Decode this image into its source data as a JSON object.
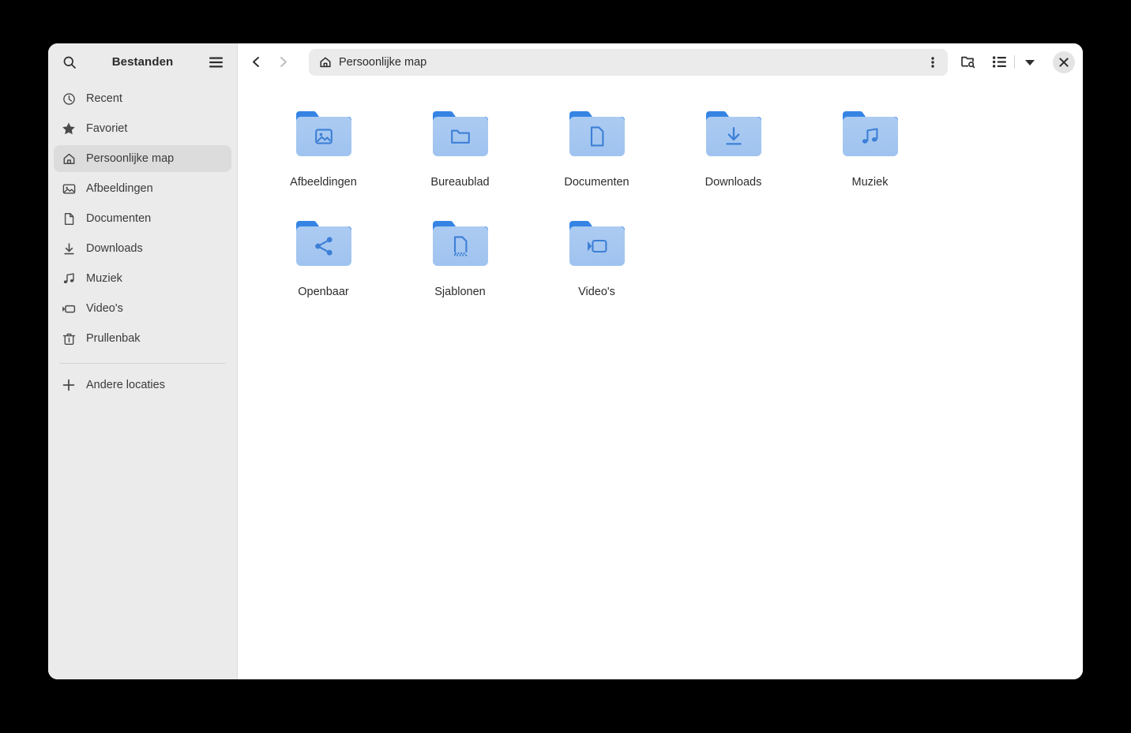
{
  "window": {
    "app_title": "Bestanden",
    "background_color": "#000000",
    "surface_color": "#ffffff",
    "sidebar_color": "#ebebeb",
    "accent_color": "#3584e4"
  },
  "sidebar": {
    "title": "Bestanden",
    "search_icon": "search-icon",
    "menu_icon": "hamburger-menu-icon",
    "items": [
      {
        "label": "Recent",
        "icon": "clock-icon",
        "selected": false
      },
      {
        "label": "Favoriet",
        "icon": "star-icon",
        "selected": false
      },
      {
        "label": "Persoonlijke map",
        "icon": "home-icon",
        "selected": true
      },
      {
        "label": "Afbeeldingen",
        "icon": "image-icon",
        "selected": false
      },
      {
        "label": "Documenten",
        "icon": "document-icon",
        "selected": false
      },
      {
        "label": "Downloads",
        "icon": "download-icon",
        "selected": false
      },
      {
        "label": "Muziek",
        "icon": "music-icon",
        "selected": false
      },
      {
        "label": "Video's",
        "icon": "video-icon",
        "selected": false
      },
      {
        "label": "Prullenbak",
        "icon": "trash-icon",
        "selected": false
      }
    ],
    "other_locations": {
      "label": "Andere locaties",
      "icon": "plus-icon"
    }
  },
  "toolbar": {
    "back_icon": "chevron-left-icon",
    "forward_icon": "chevron-right-icon",
    "path": {
      "label": "Persoonlijke map",
      "icon": "home-icon"
    },
    "path_menu_icon": "three-dots-vertical-icon",
    "search_folder_icon": "folder-search-icon",
    "view_list_icon": "list-view-icon",
    "view_dropdown_icon": "chevron-down-icon",
    "close_icon": "close-icon"
  },
  "files": [
    {
      "name": "Afbeeldingen",
      "emblem": "image-emblem"
    },
    {
      "name": "Bureaublad",
      "emblem": "folder-emblem"
    },
    {
      "name": "Documenten",
      "emblem": "document-emblem"
    },
    {
      "name": "Downloads",
      "emblem": "download-emblem"
    },
    {
      "name": "Muziek",
      "emblem": "music-emblem"
    },
    {
      "name": "Openbaar",
      "emblem": "share-emblem"
    },
    {
      "name": "Sjablonen",
      "emblem": "template-emblem"
    },
    {
      "name": "Video's",
      "emblem": "video-emblem"
    }
  ]
}
